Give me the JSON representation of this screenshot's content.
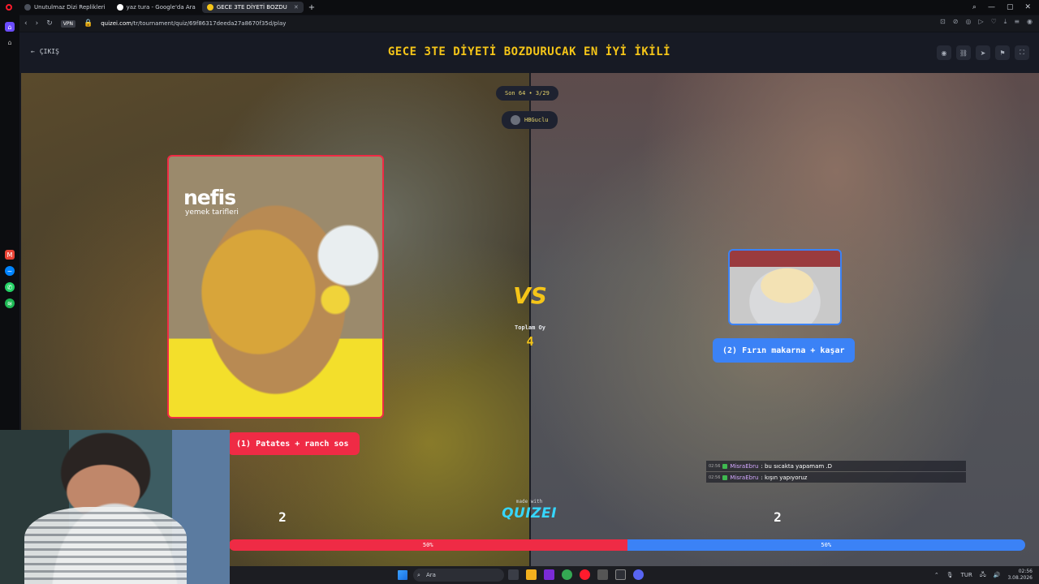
{
  "browser": {
    "tabs": [
      {
        "label": "Unutulmaz Dizi Replikleri",
        "active": false
      },
      {
        "label": "yaz tura - Google'da Ara",
        "active": false
      },
      {
        "label": "GECE 3TE DİYETİ BOZDU",
        "active": true
      }
    ],
    "url_host": "quizei.com",
    "url_path": "/tr/tournament/quiz/69f86317deeda27a8670f35d/play",
    "vpn_label": "VPN"
  },
  "page": {
    "back_label": "ÇIKIŞ",
    "title": "GECE 3TE DİYETİ BOZDURUCAK EN İYİ İKİLİ",
    "round_label": "Son 64 • 3/29",
    "author": "HBGuclu",
    "vs_label": "VS",
    "total_votes_label": "Toplam Oy",
    "total_votes": "4",
    "left": {
      "brand": "nefis",
      "brand_sub": "yemek tarifleri",
      "label": "(1) Patates + ranch sos",
      "score": "2",
      "percent_label": "50%",
      "percent": 50
    },
    "right": {
      "label": "(2) Fırın makarna + kaşar",
      "score": "2",
      "percent_label": "50%",
      "percent": 50
    },
    "made_with": "made with",
    "made_with_brand": "QUIZEI"
  },
  "chat": [
    {
      "time": "02:56",
      "user": "MisraEbru",
      "text": ": bu sıcakta yapamam .D"
    },
    {
      "time": "02:56",
      "user": "MisraEbru",
      "text": ": kışın yapıyoruz"
    }
  ],
  "taskbar": {
    "search_placeholder": "Ara",
    "lang": "TUR",
    "time": "02:56",
    "date": "3.08.2026"
  },
  "colors": {
    "accent_yellow": "#f5c518",
    "left_red": "#ef2b45",
    "right_blue": "#3b82f6"
  }
}
